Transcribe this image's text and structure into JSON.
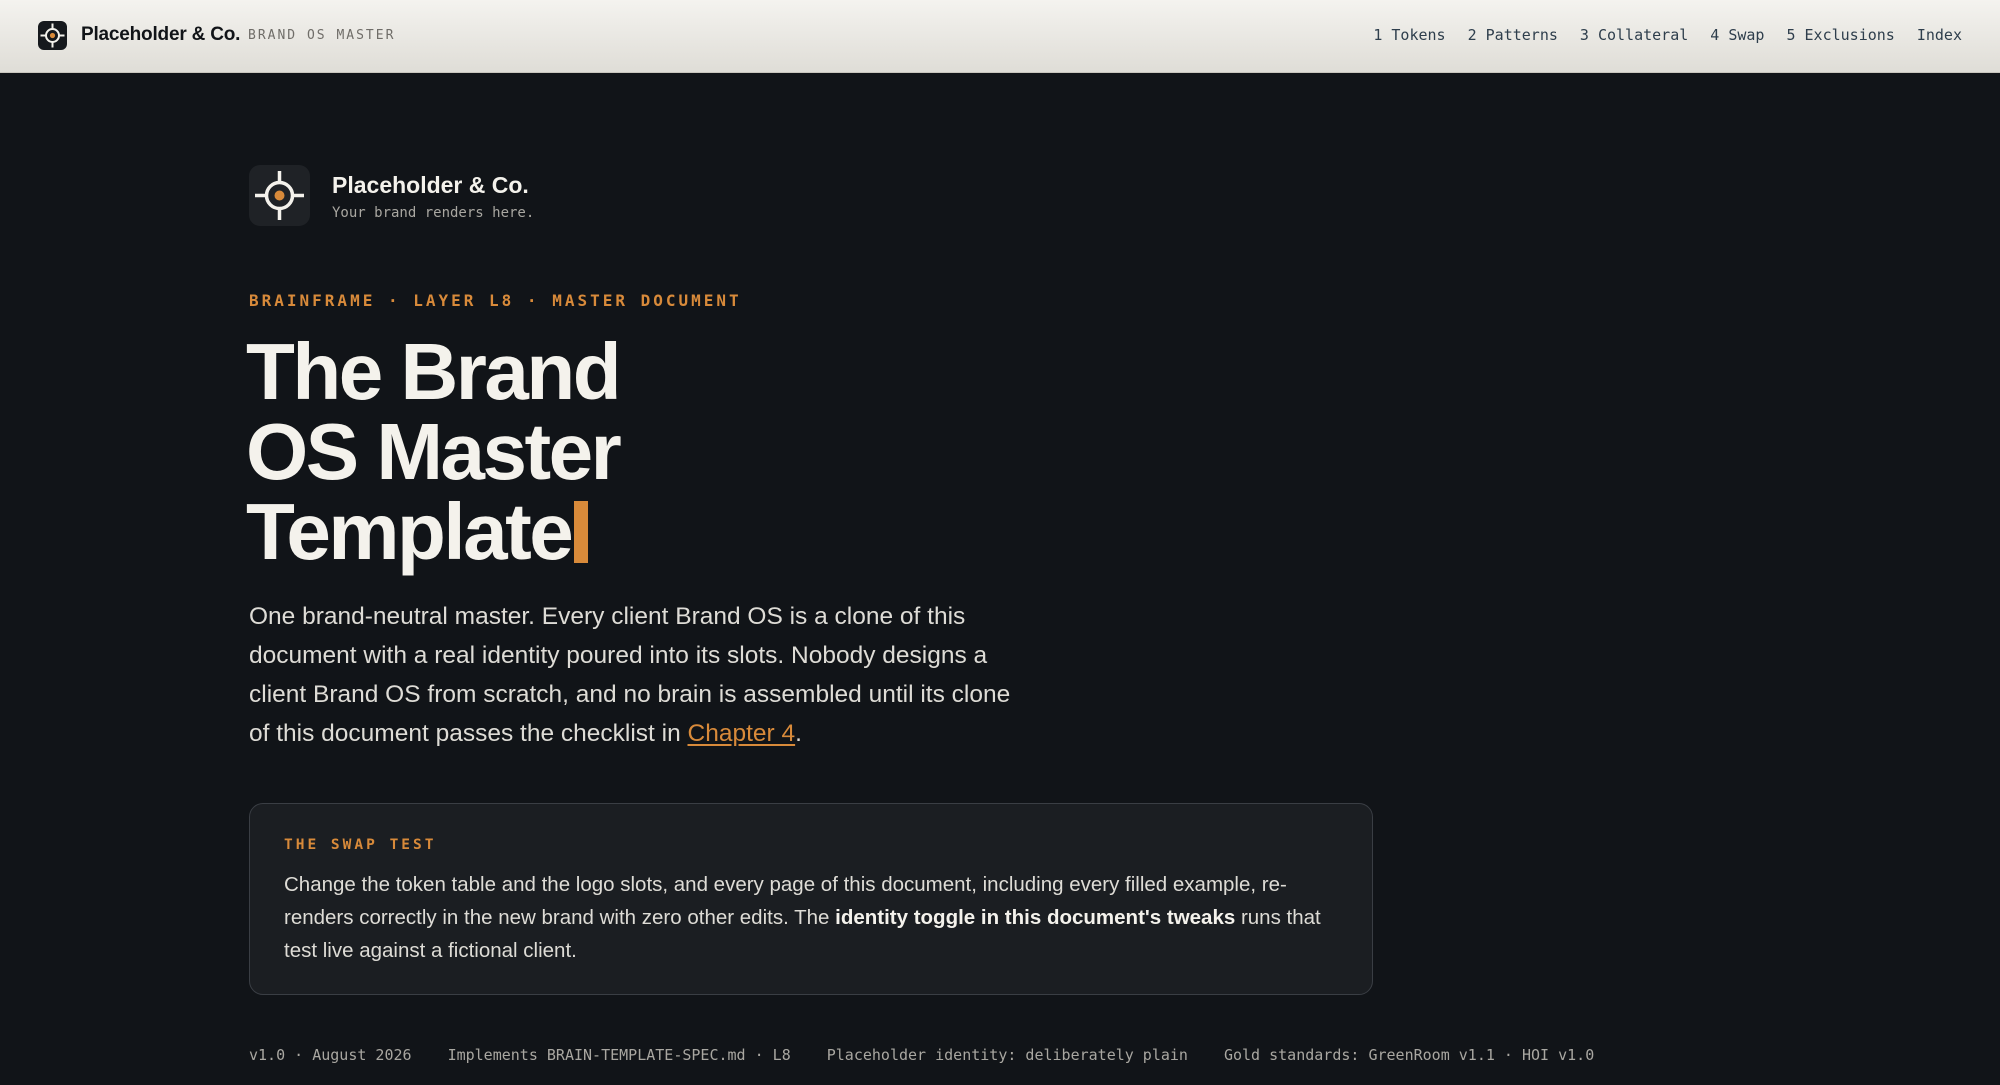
{
  "topbar": {
    "brand_name": "Placeholder & Co.",
    "brand_sub": "BRAND OS MASTER",
    "nav": [
      {
        "label": "1 Tokens"
      },
      {
        "label": "2 Patterns"
      },
      {
        "label": "3 Collateral"
      },
      {
        "label": "4 Swap"
      },
      {
        "label": "5 Exclusions"
      },
      {
        "label": "Index"
      }
    ]
  },
  "identity": {
    "name": "Placeholder & Co.",
    "tagline": "Your brand renders here."
  },
  "hero": {
    "eyebrow": "BRAINFRAME · LAYER L8 · MASTER DOCUMENT",
    "title_lines": [
      "The Brand",
      "OS Master",
      "Template"
    ],
    "lead_text": "One brand-neutral master. Every client Brand OS is a clone of this document with a real identity poured into its slots. Nobody designs a client Brand OS from scratch, and no brain is assembled until its clone of this document passes the checklist in ",
    "lead_link": "Chapter 4",
    "lead_end": "."
  },
  "callout": {
    "label": "THE SWAP TEST",
    "text_before": "Change the token table and the logo slots, and every page of this document, including every filled example, re-renders correctly in the new brand with zero other edits. The ",
    "text_strong": "identity toggle in this document's tweaks",
    "text_after": " runs that test live against a fictional client."
  },
  "meta": {
    "version": "v1.0 · August 2026",
    "implements": "Implements BRAIN-TEMPLATE-SPEC.md · L8",
    "identity_note": "Placeholder identity: deliberately plain",
    "gold": "Gold standards: GreenRoom v1.1 · HOI v1.0"
  },
  "colors": {
    "accent": "#d88a3a",
    "background": "#111418",
    "topbar": "#f4f3ef",
    "nav_text": "#2e3e4c"
  }
}
